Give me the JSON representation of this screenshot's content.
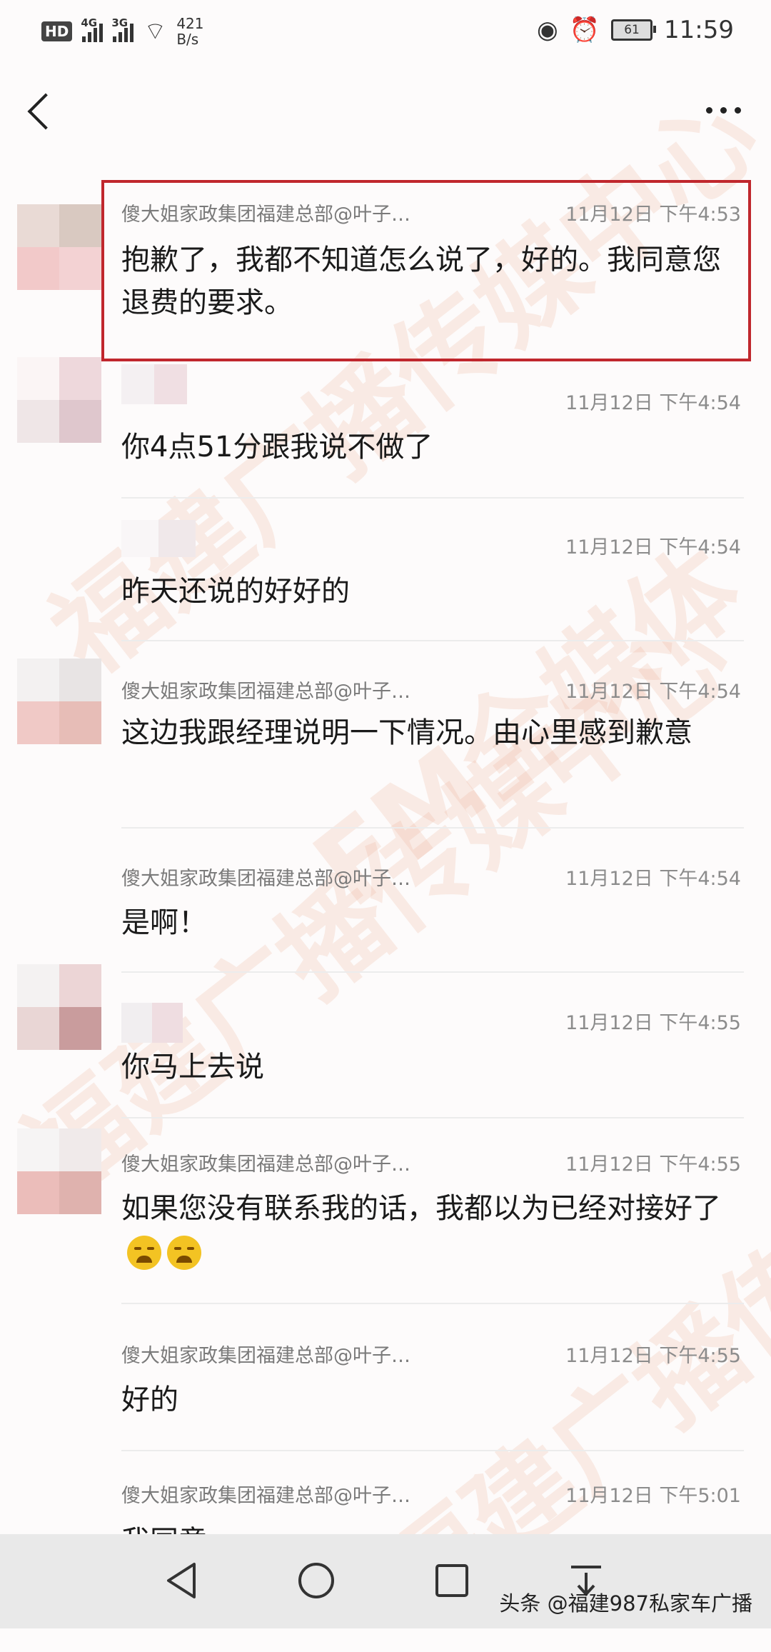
{
  "status_bar": {
    "hd": "HD",
    "sim1": "4G",
    "sim2": "3G",
    "speed_value": "421",
    "speed_unit": "B/s",
    "battery": "61",
    "time": "11:59"
  },
  "messages": [
    {
      "sender": "傻大姐家政集团福建总部@叶子…",
      "time": "11月12日 下午4:53",
      "text": "抱歉了，我都不知道怎么说了，好的。我同意您退费的要求。"
    },
    {
      "sender": "",
      "time": "11月12日 下午4:54",
      "text": "你4点51分跟我说不做了"
    },
    {
      "sender": "",
      "time": "11月12日 下午4:54",
      "text": "昨天还说的好好的"
    },
    {
      "sender": "傻大姐家政集团福建总部@叶子…",
      "time": "11月12日 下午4:54",
      "text": "这边我跟经理说明一下情况。由心里感到歉意"
    },
    {
      "sender": "傻大姐家政集团福建总部@叶子…",
      "time": "11月12日 下午4:54",
      "text": "是啊！"
    },
    {
      "sender": "",
      "time": "11月12日 下午4:55",
      "text": "你马上去说"
    },
    {
      "sender": "傻大姐家政集团福建总部@叶子…",
      "time": "11月12日 下午4:55",
      "text": "如果您没有联系我的话，我都以为已经对接好了"
    },
    {
      "sender": "傻大姐家政集团福建总部@叶子…",
      "time": "11月12日 下午4:55",
      "text": "好的"
    },
    {
      "sender": "傻大姐家政集团福建总部@叶子…",
      "time": "11月12日 下午5:01",
      "text": "我同意"
    }
  ],
  "emoji_name": "crying-face-icon",
  "watermark": [
    "福建广播传媒中心",
    "FM全媒体"
  ],
  "attribution": "头条 @福建987私家车广播",
  "colors": {
    "highlight": "#c0272d",
    "nav_bg": "#e9e9e9"
  }
}
